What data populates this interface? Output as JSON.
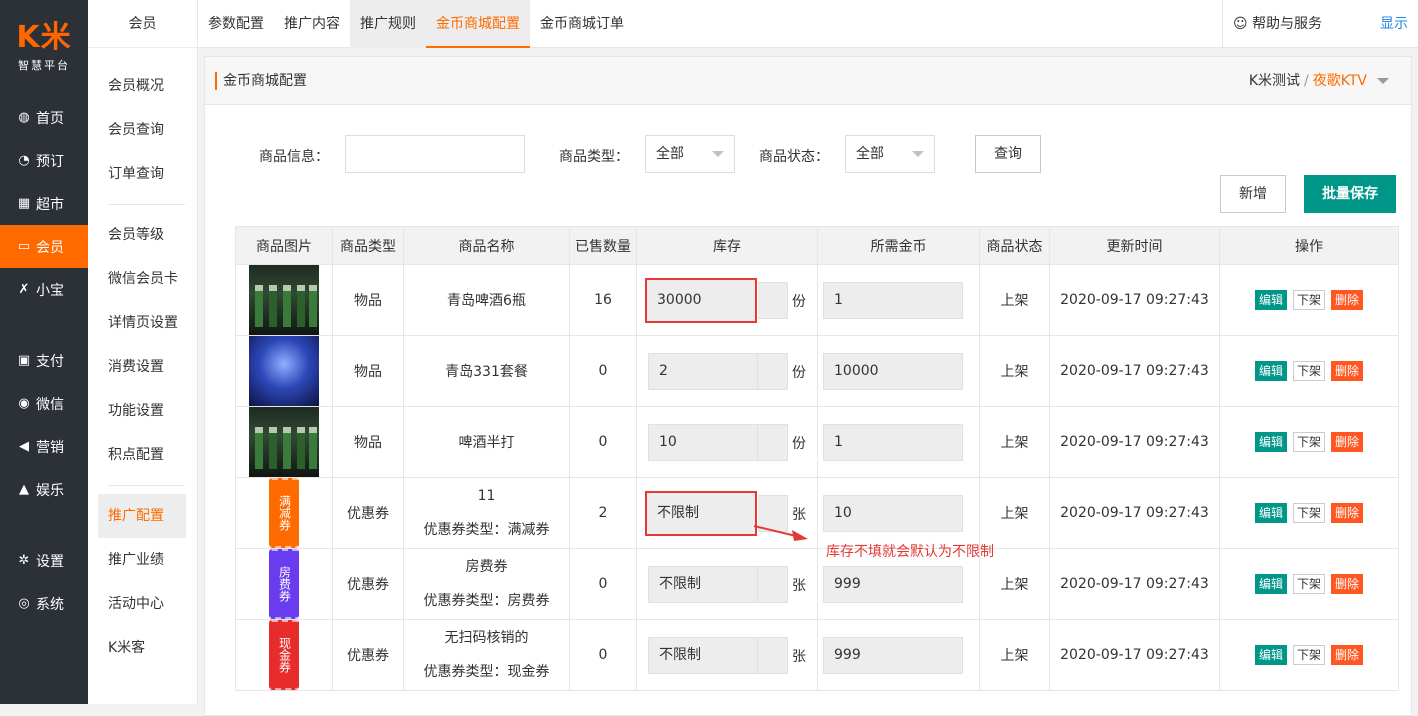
{
  "logo": {
    "mark": "K米",
    "sub": "智慧平台"
  },
  "rail": [
    {
      "label": "首页",
      "icon": "dashboard-icon"
    },
    {
      "label": "预订",
      "icon": "reserve-icon"
    },
    {
      "label": "超市",
      "icon": "basket-icon"
    },
    {
      "label": "会员",
      "icon": "card-icon",
      "active": true
    },
    {
      "label": "小宝",
      "icon": "k-icon"
    },
    {
      "label": "支付",
      "icon": "wallet-icon"
    },
    {
      "label": "微信",
      "icon": "wechat-icon"
    },
    {
      "label": "营销",
      "icon": "megaphone-icon"
    },
    {
      "label": "娱乐",
      "icon": "lock-icon"
    },
    {
      "label": "设置",
      "icon": "gear-icon"
    },
    {
      "label": "系统",
      "icon": "chrome-icon"
    }
  ],
  "menu": {
    "head": "会员",
    "items": [
      "会员概况",
      "会员查询",
      "订单查询",
      "会员等级",
      "微信会员卡",
      "详情页设置",
      "消费设置",
      "功能设置",
      "积点配置",
      "推广配置",
      "推广业绩",
      "活动中心",
      "K米客"
    ]
  },
  "tabs": [
    "参数配置",
    "推广内容",
    "推广规则",
    "金币商城配置",
    "金币商城订单"
  ],
  "help": "帮助与服务",
  "show": "显示",
  "panel": {
    "title": "金币商城配置",
    "crumb_a": "K米测试",
    "crumb_sep": "/",
    "crumb_b": "夜歌KTV"
  },
  "filters": {
    "info_label": "商品信息：",
    "type_label": "商品类型：",
    "type_value": "全部",
    "status_label": "商品状态：",
    "status_value": "全部",
    "query": "查询",
    "add": "新增",
    "batch_save": "批量保存"
  },
  "table": {
    "headers": [
      "商品图片",
      "商品类型",
      "商品名称",
      "已售数量",
      "库存",
      "所需金币",
      "商品状态",
      "更新时间",
      "操作"
    ],
    "rows": [
      {
        "img": "beer",
        "type": "物品",
        "name": "青岛啤酒6瓶",
        "sub": "",
        "sold": "16",
        "stock": "30000",
        "unit": "份",
        "coins": "1",
        "status": "上架",
        "time": "2020-09-17 09:27:43"
      },
      {
        "img": "ice",
        "type": "物品",
        "name": "青岛331套餐",
        "sub": "",
        "sold": "0",
        "stock": "2",
        "unit": "份",
        "coins": "10000",
        "status": "上架",
        "time": "2020-09-17 09:27:43"
      },
      {
        "img": "beer",
        "type": "物品",
        "name": "啤酒半打",
        "sub": "",
        "sold": "0",
        "stock": "10",
        "unit": "份",
        "coins": "1",
        "status": "上架",
        "time": "2020-09-17 09:27:43"
      },
      {
        "img": "coupon",
        "coupon_text": "满减券",
        "coupon_color": "#ff6a00",
        "type": "优惠券",
        "name": "11",
        "sub": "优惠券类型：满减券",
        "sold": "2",
        "stock": "不限制",
        "unit": "张",
        "coins": "10",
        "status": "上架",
        "time": "2020-09-17 09:27:43"
      },
      {
        "img": "coupon",
        "coupon_text": "房费券",
        "coupon_color": "#6a3cf0",
        "type": "优惠券",
        "name": "房费券",
        "sub": "优惠券类型：房费券",
        "sold": "0",
        "stock": "不限制",
        "unit": "张",
        "coins": "999",
        "status": "上架",
        "time": "2020-09-17 09:27:43"
      },
      {
        "img": "coupon",
        "coupon_text": "现金券",
        "coupon_color": "#e82c2c",
        "type": "优惠券",
        "name": "无扫码核销的",
        "sub": "优惠券类型：现金券",
        "sold": "0",
        "stock": "不限制",
        "unit": "张",
        "coins": "999",
        "status": "上架",
        "time": "2020-09-17 09:27:43"
      }
    ],
    "ops": {
      "edit": "编辑",
      "off": "下架",
      "del": "删除"
    }
  },
  "annotation": "库存不填就会默认为不限制",
  "colors": {
    "accent": "#ff6a00",
    "primary": "#009688",
    "danger": "#ff5722",
    "rail": "#2b3137",
    "annotation": "#e53935"
  }
}
